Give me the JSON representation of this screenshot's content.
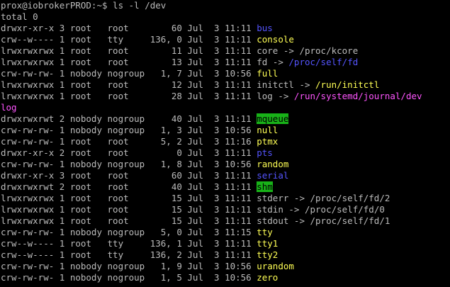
{
  "window": {
    "prompt": "prox@iobrokerPROD:~$ ",
    "command": "ls -l /dev",
    "total": "total 0"
  },
  "colors": {
    "background": "#000000",
    "text": "#bbbbbb",
    "yellow": "#ffff55",
    "blue": "#5555ff",
    "magenta": "#ff55ff",
    "green_highlight": "#18b218"
  },
  "listing": [
    {
      "meta": "drwxr-xr-x 3 root   root        60 Jul  3 11:11 ",
      "name": "bus",
      "name_color": "blue",
      "target": "",
      "target_color": ""
    },
    {
      "meta": "crw--w---- 1 root   tty     136, 0 Jul  3 11:11 ",
      "name": "console",
      "name_color": "yellow",
      "target": "",
      "target_color": ""
    },
    {
      "meta": "lrwxrwxrwx 1 root   root        11 Jul  3 11:11 ",
      "name": "core",
      "name_color": "white",
      "target": "/proc/kcore",
      "target_color": "white"
    },
    {
      "meta": "lrwxrwxrwx 1 root   root        13 Jul  3 11:11 ",
      "name": "fd",
      "name_color": "white",
      "target": "/proc/self/fd",
      "target_color": "blue"
    },
    {
      "meta": "crw-rw-rw- 1 nobody nogroup   1, 7 Jul  3 10:56 ",
      "name": "full",
      "name_color": "yellow",
      "target": "",
      "target_color": ""
    },
    {
      "meta": "lrwxrwxrwx 1 root   root        12 Jul  3 11:11 ",
      "name": "initctl",
      "name_color": "white",
      "target": "/run/initctl",
      "target_color": "yellow"
    },
    {
      "meta": "lrwxrwxrwx 1 root   root        28 Jul  3 11:11 ",
      "name": "log",
      "name_color": "white",
      "target": "/run/systemd/journal/dev",
      "target_color": "magenta"
    },
    {
      "meta": "",
      "name": "log",
      "name_color": "magenta",
      "target": "",
      "target_color": ""
    },
    {
      "meta": "drwxrwxrwt 2 nobody nogroup     40 Jul  3 11:11 ",
      "name": "mqueue",
      "name_color": "green",
      "target": "",
      "target_color": ""
    },
    {
      "meta": "crw-rw-rw- 1 nobody nogroup   1, 3 Jul  3 10:56 ",
      "name": "null",
      "name_color": "yellow",
      "target": "",
      "target_color": ""
    },
    {
      "meta": "crw-rw-rw- 1 root   root      5, 2 Jul  3 11:16 ",
      "name": "ptmx",
      "name_color": "yellow",
      "target": "",
      "target_color": ""
    },
    {
      "meta": "drwxr-xr-x 2 root   root         0 Jul  3 11:11 ",
      "name": "pts",
      "name_color": "blue",
      "target": "",
      "target_color": ""
    },
    {
      "meta": "crw-rw-rw- 1 nobody nogroup   1, 8 Jul  3 10:56 ",
      "name": "random",
      "name_color": "yellow",
      "target": "",
      "target_color": ""
    },
    {
      "meta": "drwxr-xr-x 3 root   root        60 Jul  3 11:11 ",
      "name": "serial",
      "name_color": "blue",
      "target": "",
      "target_color": ""
    },
    {
      "meta": "drwxrwxrwt 2 root   root        40 Jul  3 11:11 ",
      "name": "shm",
      "name_color": "green",
      "target": "",
      "target_color": ""
    },
    {
      "meta": "lrwxrwxrwx 1 root   root        15 Jul  3 11:11 ",
      "name": "stderr",
      "name_color": "white",
      "target": "/proc/self/fd/2",
      "target_color": "white"
    },
    {
      "meta": "lrwxrwxrwx 1 root   root        15 Jul  3 11:11 ",
      "name": "stdin",
      "name_color": "white",
      "target": "/proc/self/fd/0",
      "target_color": "white"
    },
    {
      "meta": "lrwxrwxrwx 1 root   root        15 Jul  3 11:11 ",
      "name": "stdout",
      "name_color": "white",
      "target": "/proc/self/fd/1",
      "target_color": "white"
    },
    {
      "meta": "crw-rw-rw- 1 nobody nogroup   5, 0 Jul  3 11:15 ",
      "name": "tty",
      "name_color": "yellow",
      "target": "",
      "target_color": ""
    },
    {
      "meta": "crw--w---- 1 root   tty     136, 1 Jul  3 11:11 ",
      "name": "tty1",
      "name_color": "yellow",
      "target": "",
      "target_color": ""
    },
    {
      "meta": "crw--w---- 1 root   tty     136, 2 Jul  3 11:11 ",
      "name": "tty2",
      "name_color": "yellow",
      "target": "",
      "target_color": ""
    },
    {
      "meta": "crw-rw-rw- 1 nobody nogroup   1, 9 Jul  3 10:56 ",
      "name": "urandom",
      "name_color": "yellow",
      "target": "",
      "target_color": ""
    },
    {
      "meta": "crw-rw-rw- 1 nobody nogroup   1, 5 Jul  3 10:56 ",
      "name": "zero",
      "name_color": "yellow",
      "target": "",
      "target_color": ""
    }
  ]
}
